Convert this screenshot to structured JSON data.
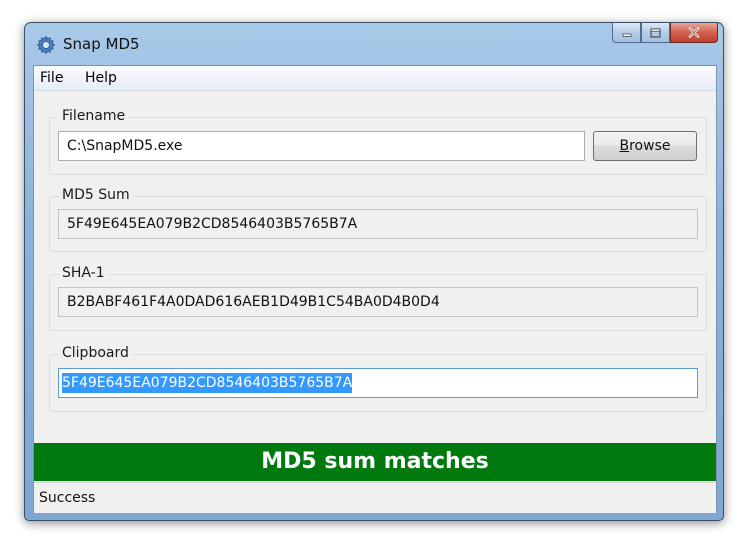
{
  "window": {
    "title": "Snap MD5",
    "icon": "gear-icon"
  },
  "menu": {
    "items": [
      {
        "label": "File"
      },
      {
        "label": "Help"
      }
    ]
  },
  "filename": {
    "label": "Filename",
    "value": "C:\\SnapMD5.exe",
    "browse_label": "Browse",
    "browse_mnemonic": "B",
    "browse_rest": "rowse"
  },
  "md5": {
    "label": "MD5 Sum",
    "value": "5F49E645EA079B2CD8546403B5765B7A"
  },
  "sha1": {
    "label": "SHA-1",
    "value": "B2BABF461F4A0DAD616AEB1D49B1C54BA0D4B0D4"
  },
  "clipboard": {
    "label": "Clipboard",
    "value": "5F49E645EA079B2CD8546403B5765B7A"
  },
  "result": {
    "message": "MD5 sum matches",
    "color": "#007a0f"
  },
  "status": {
    "text": "Success"
  }
}
